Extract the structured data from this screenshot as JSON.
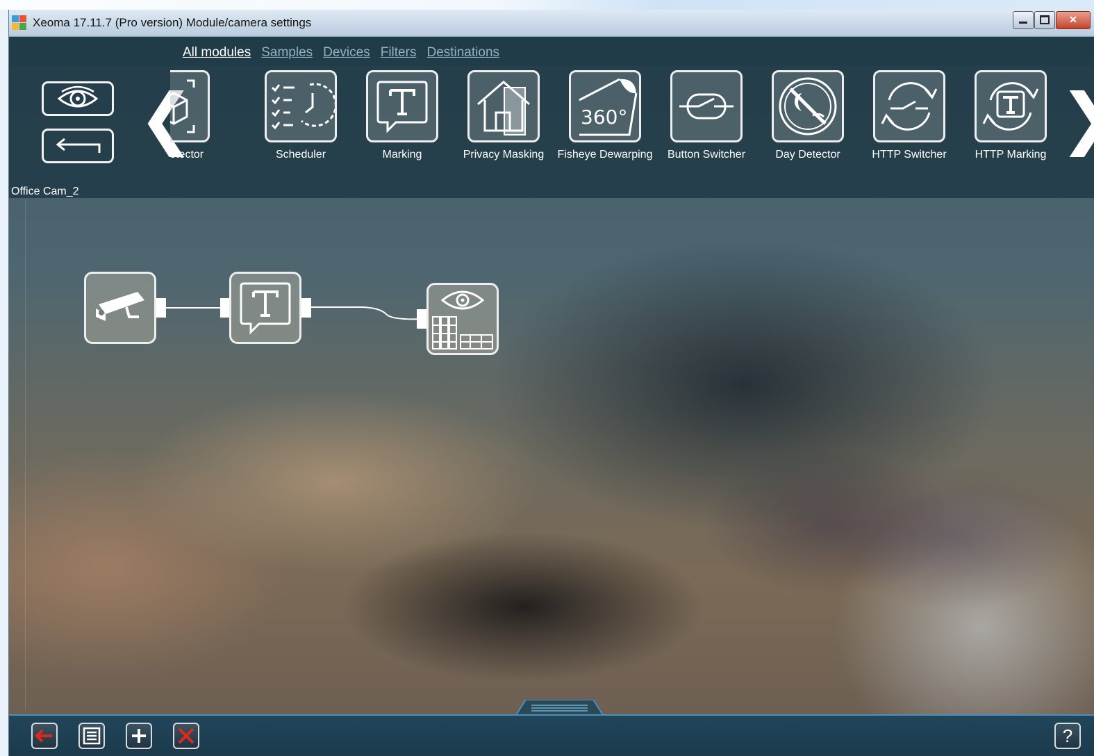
{
  "window": {
    "title": "Xeoma 17.11.7 (Pro version) Module/camera settings"
  },
  "nav": {
    "tabs": [
      {
        "label": "All modules"
      },
      {
        "label": "Samples"
      },
      {
        "label": "Devices"
      },
      {
        "label": "Filters"
      },
      {
        "label": "Destinations"
      }
    ]
  },
  "modules": [
    {
      "label": "ect Detector",
      "icon": "object-detector-icon"
    },
    {
      "label": "Scheduler",
      "icon": "scheduler-icon"
    },
    {
      "label": "Marking",
      "icon": "marking-icon"
    },
    {
      "label": "Privacy Masking",
      "icon": "privacy-masking-icon"
    },
    {
      "label": "Fisheye Dewarping",
      "icon": "fisheye-icon"
    },
    {
      "label": "Button Switcher",
      "icon": "button-switcher-icon"
    },
    {
      "label": "Day Detector",
      "icon": "day-detector-icon"
    },
    {
      "label": "HTTP Switcher",
      "icon": "http-switcher-icon"
    },
    {
      "label": "HTTP Marking",
      "icon": "http-marking-icon"
    }
  ],
  "fisheye_badge": "360°",
  "camera": {
    "name": "Office Cam_2"
  },
  "chain": [
    {
      "icon": "camera-icon"
    },
    {
      "icon": "marking-icon"
    },
    {
      "icon": "preview-archive-icon"
    }
  ],
  "help_label": "?",
  "colors": {
    "accent": "#4a90b8",
    "panel": "#1f3b47",
    "delete": "#e0281c"
  }
}
